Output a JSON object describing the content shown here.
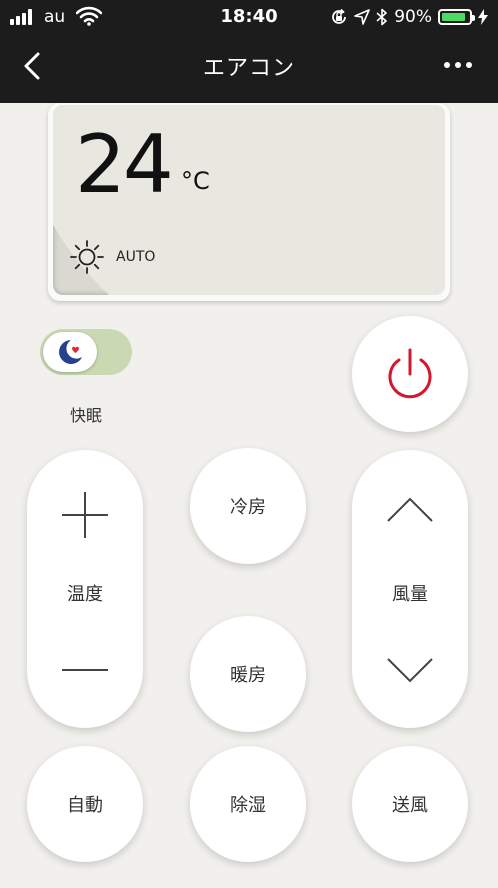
{
  "status_bar": {
    "carrier": "au",
    "time": "18:40",
    "battery_percent": "90%",
    "battery_level": 0.9,
    "battery_color": "#4cd964"
  },
  "nav": {
    "back_icon": "chevron-left-icon",
    "title": "エアコン",
    "more_icon": "more-dots-icon"
  },
  "display": {
    "temperature": "24",
    "unit": "°C",
    "mode": "AUTO",
    "mode_icon": "sun-icon"
  },
  "sleep_toggle": {
    "label": "快眠",
    "on": true,
    "icon": "moon-heart-icon",
    "track_color": "#c9dab3"
  },
  "power": {
    "icon": "power-icon",
    "color": "#d0192e"
  },
  "temperature_control": {
    "label": "温度",
    "increase_icon": "plus-icon",
    "decrease_icon": "minus-icon"
  },
  "fan_control": {
    "label": "風量",
    "increase_icon": "chevron-up-icon",
    "decrease_icon": "chevron-down-icon"
  },
  "modes": {
    "cool": "冷房",
    "heat": "暖房",
    "auto": "自動",
    "dehumidify": "除湿",
    "fan": "送風"
  }
}
